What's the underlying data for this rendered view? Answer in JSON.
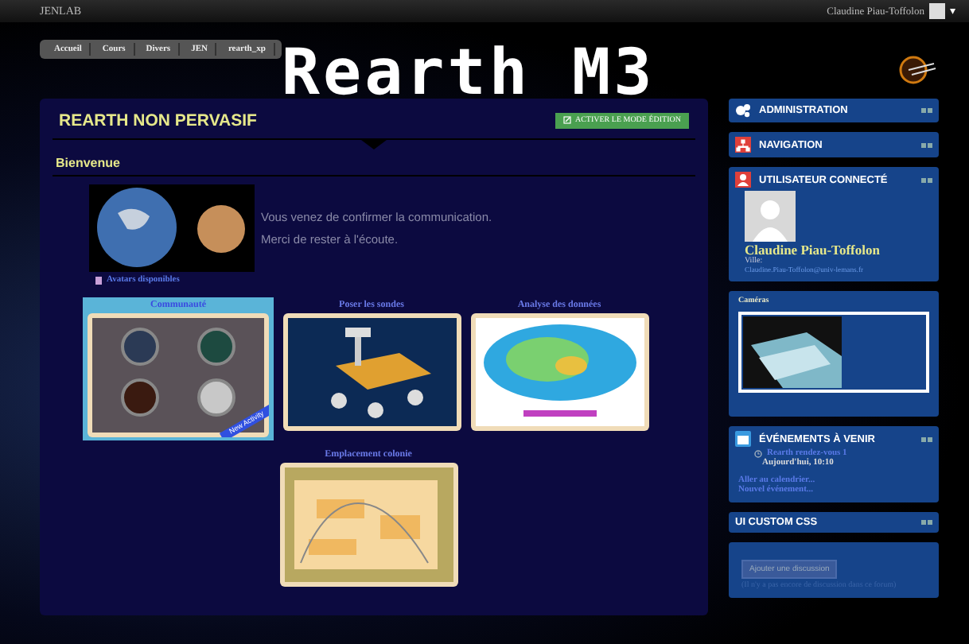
{
  "topbar": {
    "brand": "JENLAB",
    "user": "Claudine Piau-Toffolon",
    "caret": "▾"
  },
  "breadcrumbs": [
    {
      "label": "Accueil"
    },
    {
      "label": "Cours"
    },
    {
      "label": "Divers"
    },
    {
      "label": "JEN"
    },
    {
      "label": "rearth_xp"
    }
  ],
  "banner_title": "Rearth M3",
  "main": {
    "title": "REARTH NON PERVASIF",
    "edit_button": "ACTIVER LE MODE ÉDITION",
    "section": "Bienvenue",
    "message_lines": [
      "Vous venez de confirmer la communication.",
      "Merci de rester à l'écoute."
    ],
    "avatars_link": "Avatars disponibles",
    "tiles": [
      {
        "title": "Communauté",
        "kind": "apps",
        "selected": true,
        "badge": "New Activity"
      },
      {
        "title": "Poser les sondes",
        "kind": "rover",
        "selected": false
      },
      {
        "title": "Analyse des données",
        "kind": "map",
        "selected": false
      },
      {
        "title": "Emplacement colonie",
        "kind": "chart",
        "selected": false
      }
    ]
  },
  "sidebar": [
    {
      "kind": "admin",
      "title": "ADMINISTRATION"
    },
    {
      "kind": "nav",
      "title": "NAVIGATION"
    },
    {
      "kind": "user",
      "title": "UTILISATEUR CONNECTÉ",
      "name": "Claudine Piau-Toffolon",
      "city": "Ville:",
      "email": "Claudine.Piau-Toffolon@univ-lemans.fr"
    },
    {
      "kind": "camera",
      "title": "Caméras"
    },
    {
      "kind": "events",
      "title": "ÉVÉNEMENTS À VENIR",
      "event": "Rearth rendez-vous 1",
      "time": "Aujourd'hui, 10:10",
      "links": [
        "Aller au calendrier...",
        "Nouvel événement..."
      ]
    },
    {
      "kind": "css",
      "title": "UI CUSTOM CSS"
    },
    {
      "kind": "forum",
      "button": "Ajouter une discussion",
      "note": "(Il n'y a pas encore de discussion dans ce forum)"
    }
  ]
}
